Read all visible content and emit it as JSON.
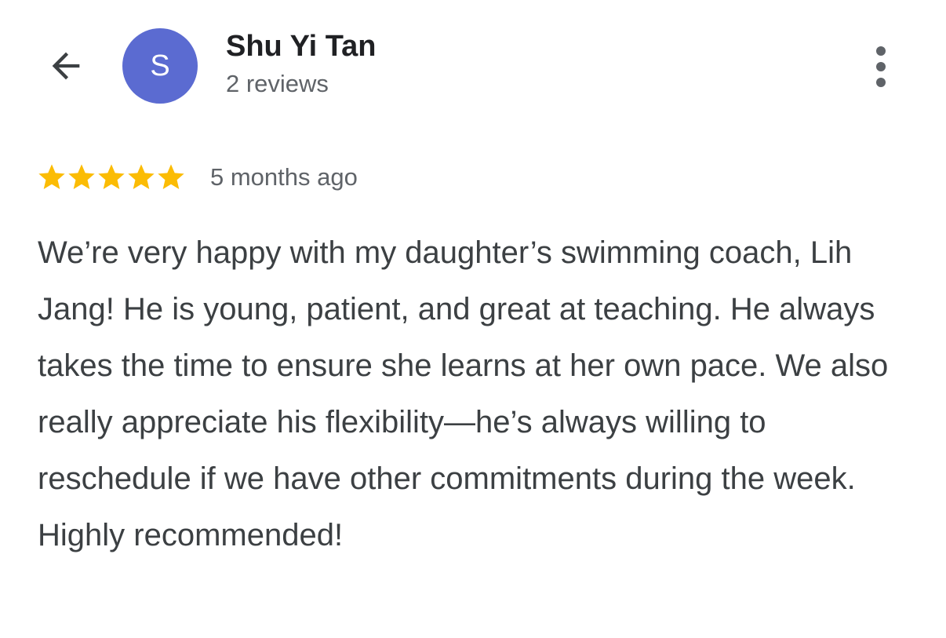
{
  "header": {
    "back_icon": "arrow-left-icon",
    "avatar_initial": "S",
    "avatar_color": "#5b6bd1",
    "reviewer_name": "Shu Yi Tan",
    "review_count": "2 reviews",
    "more_icon": "more-vert-icon"
  },
  "review": {
    "rating": 5,
    "rating_max": 5,
    "star_color": "#fbbc04",
    "date": "5 months ago",
    "text": "We’re very happy with my daughter’s swimming coach, Lih Jang! He is young, patient, and great at teaching. He always takes the time to ensure she learns at her own pace. We also really appreciate his flexibility—he’s always willing to reschedule if we have other commitments during the week. Highly recommended!"
  }
}
